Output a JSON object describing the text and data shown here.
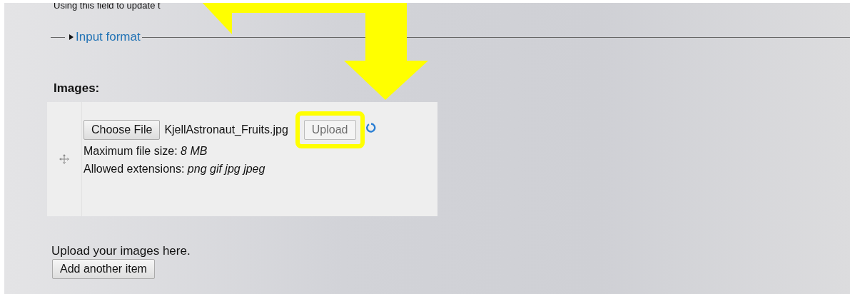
{
  "intro_text": "Using this field to update t",
  "input_format": {
    "label": "Input format",
    "expanded": false
  },
  "images_field": {
    "label": "Images:",
    "choose_button": "Choose File",
    "file_name": "KjellAstronaut_Fruits.jpg",
    "upload_button": {
      "label": "Upload",
      "disabled": true
    },
    "max_size": "Maximum file size: *8 MB*",
    "extensions": "Allowed extensions: *png gif jpg jpeg*",
    "description": "Upload your images here.",
    "add_button": "Add another item"
  }
}
